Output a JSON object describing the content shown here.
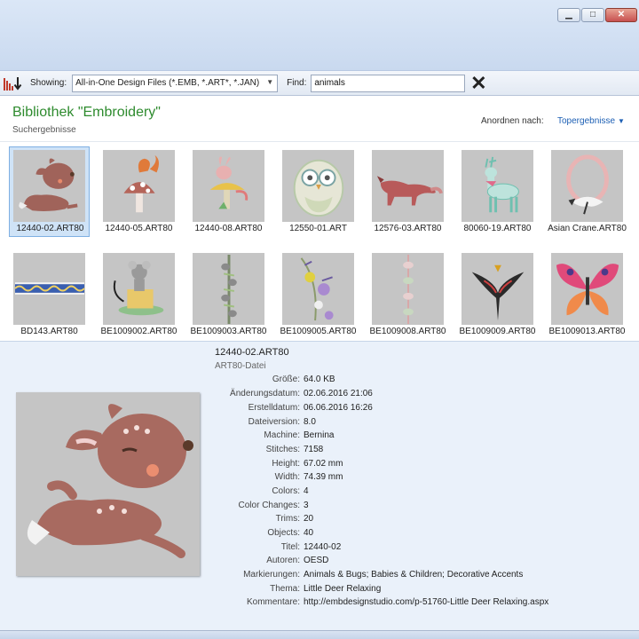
{
  "window": {
    "minimize_glyph": "▁",
    "maximize_glyph": "□",
    "close_glyph": "✕"
  },
  "toolbar": {
    "showing_label": "Showing:",
    "showing_value": "All-in-One Design Files (*.EMB, *.ART*, *.JAN)",
    "find_label": "Find:",
    "find_value": "animals",
    "clear_glyph": "✕"
  },
  "library": {
    "title": "Bibliothek \"Embroidery\"",
    "subtitle": "Suchergebnisse",
    "sort_label": "Anordnen nach:",
    "sort_value": "Topergebnisse"
  },
  "results": [
    {
      "name": "12440-02.ART80",
      "icon": "deer-thumbnail-icon",
      "selected": true
    },
    {
      "name": "12440-05.ART80",
      "icon": "squirrel-mushroom-thumbnail-icon"
    },
    {
      "name": "12440-08.ART80",
      "icon": "bunny-mushroom-thumbnail-icon"
    },
    {
      "name": "12550-01.ART",
      "icon": "owl-thumbnail-icon"
    },
    {
      "name": "12576-03.ART80",
      "icon": "fox-thumbnail-icon"
    },
    {
      "name": "80060-19.ART80",
      "icon": "reindeer-thumbnail-icon"
    },
    {
      "name": "Asian Crane.ART80",
      "icon": "crane-wreath-thumbnail-icon"
    },
    {
      "name": "BD143.ART80",
      "icon": "border-band-thumbnail-icon"
    },
    {
      "name": "BE1009002.ART80",
      "icon": "mouse-cake-thumbnail-icon"
    },
    {
      "name": "BE1009003.ART80",
      "icon": "vertical-border-thumbnail-icon"
    },
    {
      "name": "BE1009005.ART80",
      "icon": "flower-border-thumbnail-icon"
    },
    {
      "name": "BE1009008.ART80",
      "icon": "vertical-border-thumbnail-icon"
    },
    {
      "name": "BE1009009.ART80",
      "icon": "bird-thumbnail-icon"
    },
    {
      "name": "BE1009013.ART80",
      "icon": "butterfly-thumbnail-icon"
    }
  ],
  "details": {
    "file_name": "12440-02.ART80",
    "file_type": "ART80-Datei",
    "properties": [
      {
        "key": "Größe:",
        "value": "64.0 KB"
      },
      {
        "key": "Änderungsdatum:",
        "value": "02.06.2016 21:06"
      },
      {
        "key": "Erstelldatum:",
        "value": "06.06.2016 16:26"
      },
      {
        "key": "Dateiversion:",
        "value": "8.0"
      },
      {
        "key": "Machine:",
        "value": "Bernina"
      },
      {
        "key": "Stitches:",
        "value": "7158"
      },
      {
        "key": "Height:",
        "value": "67.02 mm"
      },
      {
        "key": "Width:",
        "value": "74.39 mm"
      },
      {
        "key": "Colors:",
        "value": "4"
      },
      {
        "key": "Color Changes:",
        "value": "3"
      },
      {
        "key": "Trims:",
        "value": "20"
      },
      {
        "key": "Objects:",
        "value": "40"
      },
      {
        "key": "Titel:",
        "value": "12440-02"
      },
      {
        "key": "Autoren:",
        "value": "OESD"
      },
      {
        "key": "Markierungen:",
        "value": "Animals & Bugs; Babies & Children; Decorative Accents"
      },
      {
        "key": "Thema:",
        "value": "Little Deer Relaxing"
      },
      {
        "key": "Kommentare:",
        "value": "http://embdesignstudio.com/p-51760-Little Deer Relaxing.aspx"
      }
    ]
  }
}
